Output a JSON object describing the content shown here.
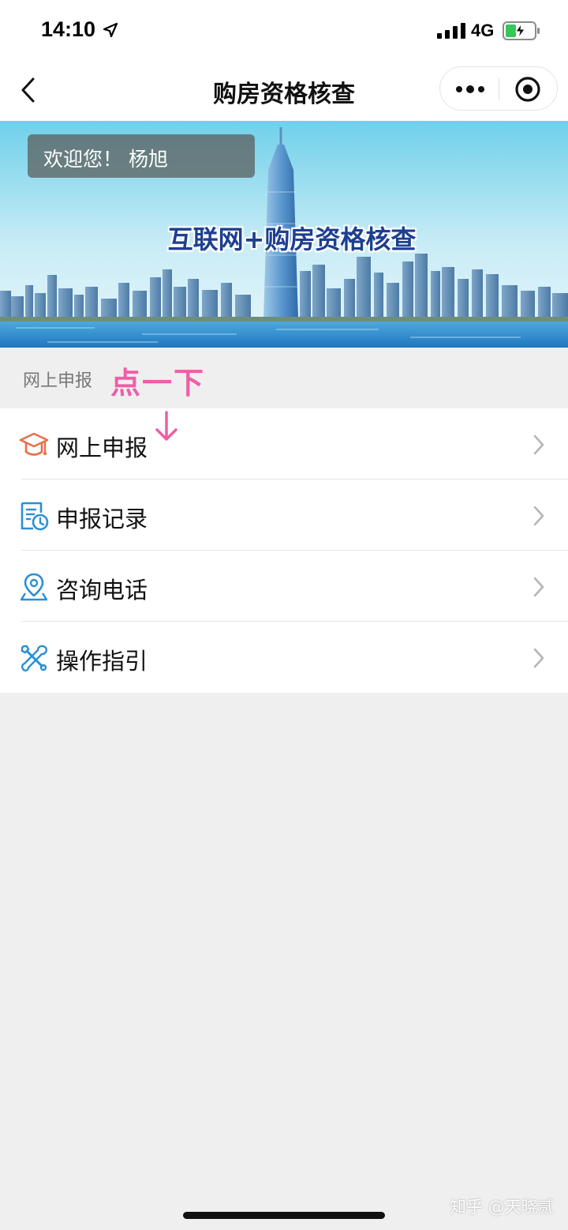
{
  "status_bar": {
    "time": "14:10",
    "network": "4G",
    "icons": [
      "location-arrow-icon",
      "signal-icon",
      "battery-charging-icon"
    ]
  },
  "nav_bar": {
    "title": "购房资格核查",
    "back_icon": "chevron-left-icon",
    "more_icon": "more-dots-icon",
    "close_icon": "target-close-icon"
  },
  "banner": {
    "welcome": "欢迎您！ 杨旭",
    "title": "互联网+购房资格核查"
  },
  "section": {
    "title": "网上申报",
    "annotation": "点一下"
  },
  "menu": {
    "items": [
      {
        "label": "网上申报",
        "icon": "graduation-cap-icon"
      },
      {
        "label": "申报记录",
        "icon": "record-document-icon"
      },
      {
        "label": "咨询电话",
        "icon": "location-pin-icon"
      },
      {
        "label": "操作指引",
        "icon": "tools-icon"
      }
    ]
  },
  "watermark": "知乎 @天晓贰",
  "colors": {
    "accent_blue": "#2a8fd6",
    "accent_orange": "#e8704a",
    "annotation_pink": "#ee5fa7",
    "background": "#efefef"
  }
}
